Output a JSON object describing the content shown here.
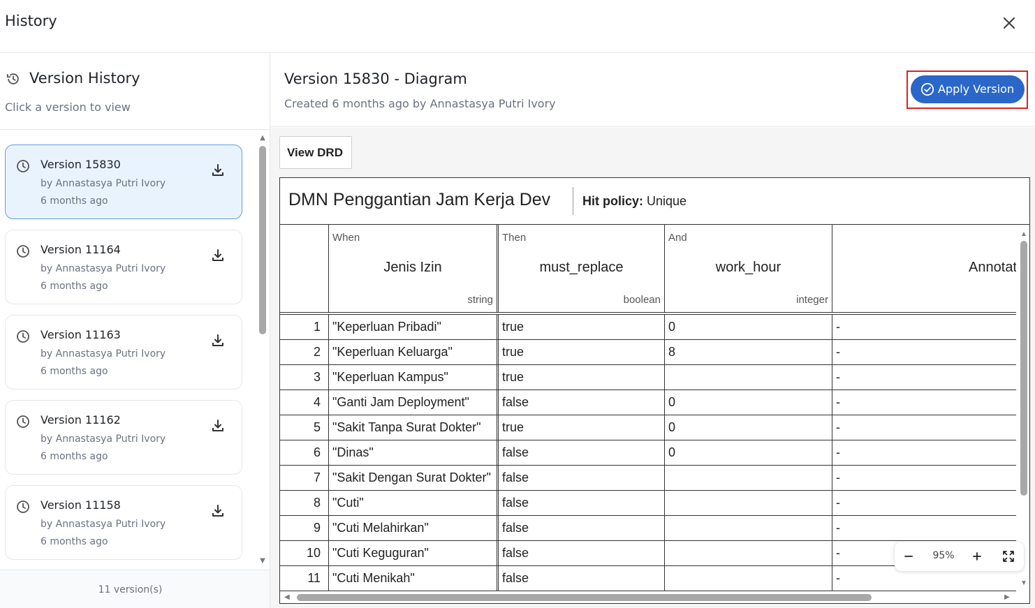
{
  "header": {
    "title": "History"
  },
  "sidebar": {
    "title": "Version History",
    "subtitle": "Click a version to view",
    "versions": [
      {
        "name": "Version 15830",
        "author": "by Annastasya Putri Ivory",
        "time": "6 months ago",
        "active": true
      },
      {
        "name": "Version 11164",
        "author": "by Annastasya Putri Ivory",
        "time": "6 months ago",
        "active": false
      },
      {
        "name": "Version 11163",
        "author": "by Annastasya Putri Ivory",
        "time": "6 months ago",
        "active": false
      },
      {
        "name": "Version 11162",
        "author": "by Annastasya Putri Ivory",
        "time": "6 months ago",
        "active": false
      },
      {
        "name": "Version 11158",
        "author": "by Annastasya Putri Ivory",
        "time": "6 months ago",
        "active": false
      }
    ],
    "footer": "11 version(s)"
  },
  "main": {
    "title": "Version 15830 - Diagram",
    "subtitle": "Created 6 months ago by Annastasya Putri Ivory",
    "apply_label": "Apply Version",
    "view_drd_label": "View DRD",
    "accent_color": "#2a67c9",
    "highlight_color": "#e02020"
  },
  "dmn": {
    "name": "DMN Penggantian Jam Kerja Dev",
    "hit_policy_label": "Hit policy:",
    "hit_policy_value": "Unique",
    "columns": [
      {
        "keyword": "When",
        "name": "Jenis Izin",
        "type": "string"
      },
      {
        "keyword": "Then",
        "name": "must_replace",
        "type": "boolean"
      },
      {
        "keyword": "And",
        "name": "work_hour",
        "type": "integer"
      },
      {
        "keyword": "",
        "name": "Annotat",
        "type": ""
      }
    ],
    "rows": [
      {
        "n": "1",
        "jenis": "\"Keperluan Pribadi\"",
        "replace": "true",
        "hour": "0",
        "ann": "-"
      },
      {
        "n": "2",
        "jenis": "\"Keperluan Keluarga\"",
        "replace": "true",
        "hour": "8",
        "ann": "-"
      },
      {
        "n": "3",
        "jenis": "\"Keperluan Kampus\"",
        "replace": "true",
        "hour": "",
        "ann": "-"
      },
      {
        "n": "4",
        "jenis": "\"Ganti Jam Deployment\"",
        "replace": "false",
        "hour": "0",
        "ann": "-"
      },
      {
        "n": "5",
        "jenis": "\"Sakit Tanpa Surat Dokter\"",
        "replace": "true",
        "hour": "0",
        "ann": "-"
      },
      {
        "n": "6",
        "jenis": "\"Dinas\"",
        "replace": "false",
        "hour": "0",
        "ann": "-"
      },
      {
        "n": "7",
        "jenis": "\"Sakit Dengan Surat Dokter\"",
        "replace": "false",
        "hour": "",
        "ann": "-"
      },
      {
        "n": "8",
        "jenis": "\"Cuti\"",
        "replace": "false",
        "hour": "",
        "ann": "-"
      },
      {
        "n": "9",
        "jenis": "\"Cuti Melahirkan\"",
        "replace": "false",
        "hour": "",
        "ann": "-"
      },
      {
        "n": "10",
        "jenis": "\"Cuti Keguguran\"",
        "replace": "false",
        "hour": "",
        "ann": "-"
      },
      {
        "n": "11",
        "jenis": "\"Cuti Menikah\"",
        "replace": "false",
        "hour": "",
        "ann": "-"
      }
    ],
    "zoom": "95%"
  }
}
